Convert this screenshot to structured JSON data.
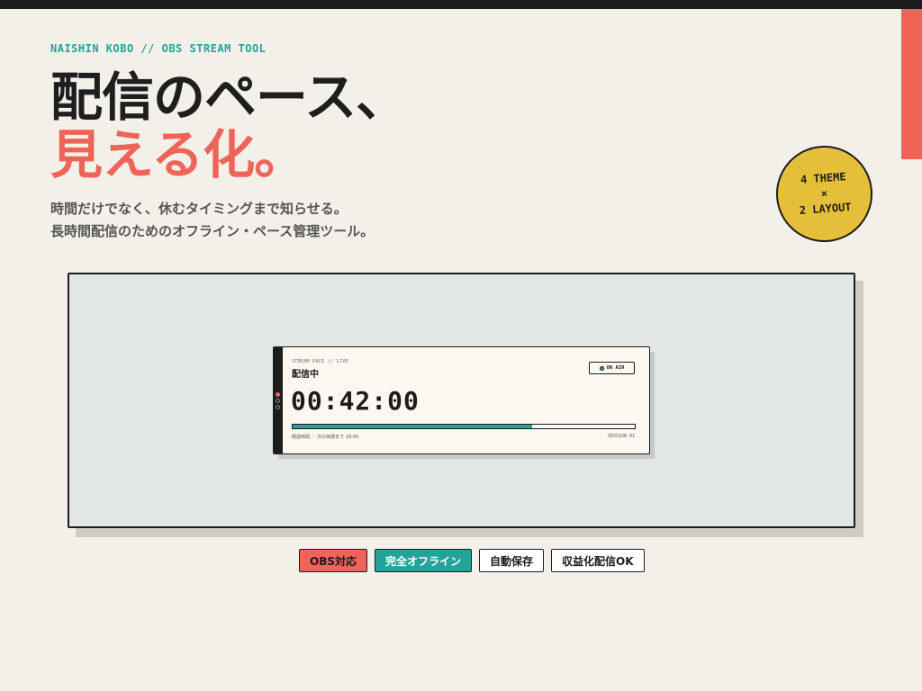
{
  "header": {
    "eyebrow": "NAISHIN KOBO // OBS STREAM TOOL",
    "headline_line1": "配信のペース、",
    "headline_line2": "見える化。",
    "subtitle_line1": "時間だけでなく、休むタイミングまで知らせる。",
    "subtitle_line2": "長時間配信のためのオフライン・ペース管理ツール。"
  },
  "badge": {
    "line1": "4 THEME",
    "line2": "×",
    "line3": "2 LAYOUT"
  },
  "widget": {
    "label": "STREAM PACE // LIVE",
    "title": "配信中",
    "status": "ON AIR",
    "timer": "00:42:00",
    "progress": 0.7,
    "footer_left": "経過時間 ／ 次の休憩まで 18:00",
    "footer_right": "SESSION 01"
  },
  "tags": [
    {
      "label": "OBS対応"
    },
    {
      "label": "完全オフライン"
    },
    {
      "label": "自動保存"
    },
    {
      "label": "収益化配信OK"
    }
  ],
  "colors": {
    "background": "#f3f0ea",
    "coral": "#ee6459",
    "teal": "#23a39a",
    "yellow": "#e6bf3a",
    "ink": "#1c1c1c"
  }
}
